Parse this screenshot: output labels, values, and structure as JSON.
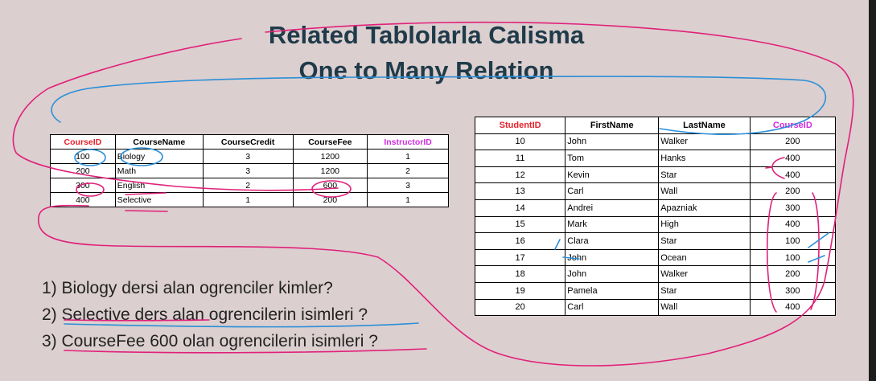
{
  "slide": {
    "title_line1": "Related Tablolarla Calisma",
    "title_line2": "One to Many Relation"
  },
  "courses_table": {
    "headers": [
      "CourseID",
      "CourseName",
      "CourseCredit",
      "CourseFee",
      "InstructorID"
    ],
    "rows": [
      [
        "100",
        "Biology",
        "3",
        "1200",
        "1"
      ],
      [
        "200",
        "Math",
        "3",
        "1200",
        "2"
      ],
      [
        "300",
        "English",
        "2",
        "600",
        "3"
      ],
      [
        "400",
        "Selective",
        "1",
        "200",
        "1"
      ]
    ]
  },
  "students_table": {
    "headers": [
      "StudentID",
      "FirstName",
      "LastName",
      "CourseID"
    ],
    "rows": [
      [
        "10",
        "John",
        "Walker",
        "200"
      ],
      [
        "11",
        "Tom",
        "Hanks",
        "400"
      ],
      [
        "12",
        "Kevin",
        "Star",
        "400"
      ],
      [
        "13",
        "Carl",
        "Wall",
        "200"
      ],
      [
        "14",
        "Andrei",
        "Apazniak",
        "300"
      ],
      [
        "15",
        "Mark",
        "High",
        "400"
      ],
      [
        "16",
        "Clara",
        "Star",
        "100"
      ],
      [
        "17",
        "John",
        "Ocean",
        "100"
      ],
      [
        "18",
        "John",
        "Walker",
        "200"
      ],
      [
        "19",
        "Pamela",
        "Star",
        "300"
      ],
      [
        "20",
        "Carl",
        "Wall",
        "400"
      ]
    ]
  },
  "questions": [
    "1) Biology dersi alan ogrenciler kimler?",
    "2) Selective ders alan ogrencilerin isimleri ?",
    "3) CourseFee 600 olan ogrencilerin isimleri ?"
  ],
  "colors": {
    "background": "#dccfcf",
    "title": "#1f3b4a",
    "header_red": "#e8202a",
    "header_magenta": "#d12ce0",
    "ink_magenta": "#e0207a",
    "ink_blue": "#2a8fd8"
  }
}
